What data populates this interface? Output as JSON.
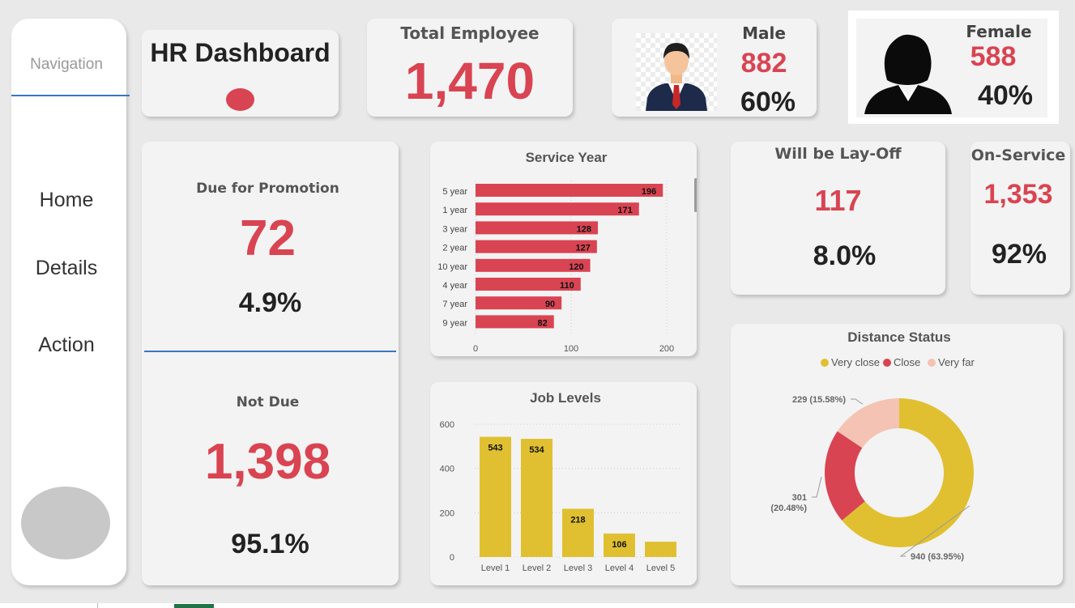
{
  "navigation": {
    "title": "Navigation",
    "items": [
      {
        "label": "Home"
      },
      {
        "label": "Details"
      },
      {
        "label": "Action"
      }
    ]
  },
  "header": {
    "title": "HR Dashboard"
  },
  "kpis": {
    "total_employee": {
      "label": "Total Employee",
      "value": "1,470"
    },
    "male": {
      "label": "Male",
      "value": "882",
      "pct": "60%"
    },
    "female": {
      "label": "Female",
      "value": "588",
      "pct": "40%"
    },
    "promotion": {
      "due_label": "Due for Promotion",
      "due_value": "72",
      "due_pct": "4.9%",
      "not_due_label": "Not Due",
      "not_due_value": "1,398",
      "not_due_pct": "95.1%"
    },
    "layoff": {
      "label": "Will be Lay-Off",
      "value": "117",
      "pct": "8.0%"
    },
    "on_service": {
      "label": "On-Service",
      "value": "1,353",
      "pct": "92%"
    }
  },
  "colors": {
    "accent_red": "#d94452",
    "gold": "#e0c030",
    "pink": "#f4c3b3",
    "nav_line": "#3a76c2"
  },
  "chart_data": [
    {
      "id": "service_year",
      "type": "bar",
      "orientation": "horizontal",
      "title": "Service Year",
      "categories": [
        "5 year",
        "1 year",
        "3 year",
        "2 year",
        "10 year",
        "4 year",
        "7 year",
        "9 year"
      ],
      "values": [
        196,
        171,
        128,
        127,
        120,
        110,
        90,
        82
      ],
      "xticks": [
        "0",
        "100",
        "200"
      ],
      "xlim": [
        0,
        200
      ],
      "color": "#d94452"
    },
    {
      "id": "job_levels",
      "type": "bar",
      "title": "Job Levels",
      "categories": [
        "Level 1",
        "Level 2",
        "Level 3",
        "Level 4",
        "Level 5"
      ],
      "values": [
        543,
        534,
        218,
        106,
        69
      ],
      "labels": [
        "543",
        "534",
        "218",
        "106",
        ""
      ],
      "yticks": [
        "0",
        "200",
        "400",
        "600"
      ],
      "ylim": [
        0,
        600
      ],
      "color": "#e0c030"
    },
    {
      "id": "distance_status",
      "type": "pie",
      "title": "Distance Status",
      "legend": [
        "Very close",
        "Close",
        "Very far"
      ],
      "legend_position": "top",
      "values": [
        940,
        301,
        229
      ],
      "labels": [
        "940 (63.95%)",
        "301 (20.48%)",
        "229 (15.58%)"
      ],
      "colors": [
        "#e0c030",
        "#d94452",
        "#f4c3b3"
      ]
    }
  ]
}
